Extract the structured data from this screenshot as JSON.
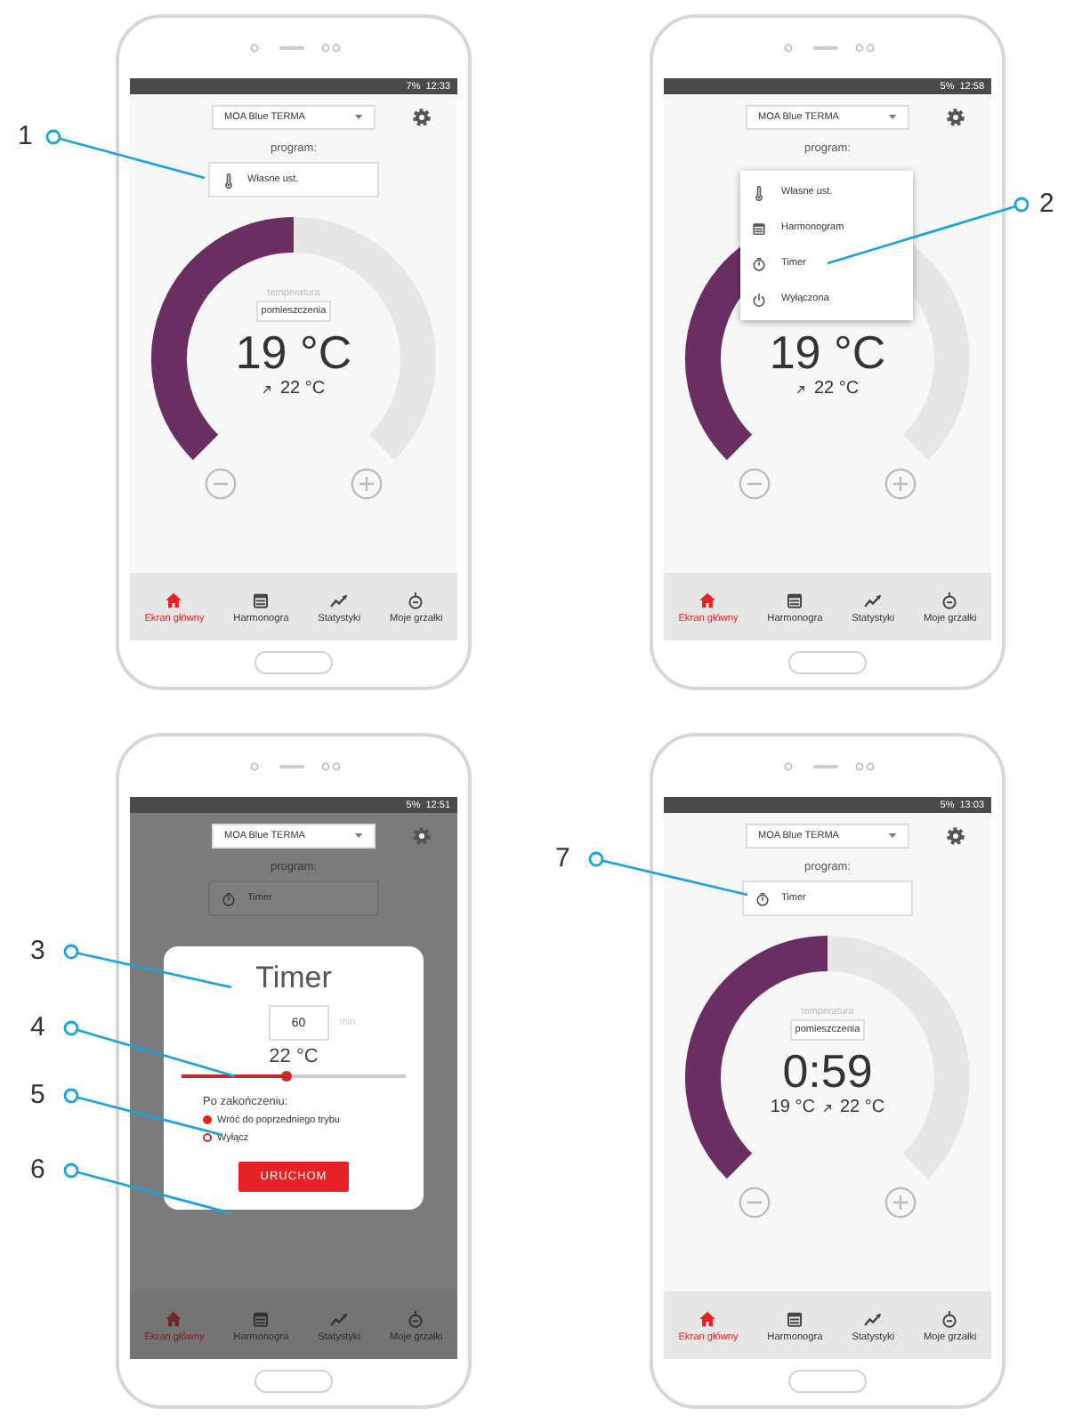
{
  "phones": [
    {
      "kind": "home",
      "status": {
        "battery": "7%",
        "time": "12:33"
      },
      "device": "MOA Blue TERMA",
      "program_label": "program:",
      "program": {
        "kind": "thermo",
        "label": "Własne ust."
      },
      "gauge": {
        "level": 0.5,
        "caption": "temperatura",
        "box": "pomieszczenia",
        "value": "19 °C",
        "target": "22 °C"
      },
      "nav": [
        {
          "kind": "home",
          "label": "Ekran główny",
          "selected": true
        },
        {
          "kind": "calendar",
          "label": "Harmonogra",
          "selected": false
        },
        {
          "kind": "chart",
          "label": "Statystyki",
          "selected": false
        },
        {
          "kind": "dial",
          "label": "Moje grzałki",
          "selected": false
        }
      ]
    },
    {
      "kind": "menu",
      "status": {
        "battery": "5%",
        "time": "12:58"
      },
      "device": "MOA Blue TERMA",
      "program_label": "program:",
      "gauge": {
        "level": 0.5,
        "value": "19 °C",
        "target": "22 °C"
      },
      "menu": [
        {
          "kind": "thermo",
          "label": "Własne ust."
        },
        {
          "kind": "calendar",
          "label": "Harmonogram"
        },
        {
          "kind": "timer",
          "label": "Timer"
        },
        {
          "kind": "power",
          "label": "Wyłączona"
        }
      ],
      "nav": [
        {
          "kind": "home",
          "label": "Ekran główny",
          "selected": true
        },
        {
          "kind": "calendar",
          "label": "Harmonogra",
          "selected": false
        },
        {
          "kind": "chart",
          "label": "Statystyki",
          "selected": false
        },
        {
          "kind": "dial",
          "label": "Moje grzałki",
          "selected": false
        }
      ]
    },
    {
      "kind": "dialog",
      "status": {
        "battery": "5%",
        "time": "12:51"
      },
      "device": "MOA Blue TERMA",
      "program_label": "program:",
      "program": {
        "kind": "timer",
        "label": "Timer"
      },
      "dialog": {
        "title": "Timer",
        "minutes": "60",
        "unit": "min.",
        "temp": "22 °C",
        "level": 0.47,
        "after_label": "Po zakończeniu:",
        "options": [
          {
            "label": "Wróć do poprzedniego trybu",
            "selected": true
          },
          {
            "label": "Wyłącz",
            "selected": false
          }
        ],
        "button": "URUCHOM"
      },
      "nav": [
        {
          "kind": "home",
          "label": "Ekran główny",
          "selected": true
        },
        {
          "kind": "calendar",
          "label": "Harmonogra",
          "selected": false
        },
        {
          "kind": "chart",
          "label": "Statystyki",
          "selected": false
        },
        {
          "kind": "dial",
          "label": "Moje grzałki",
          "selected": false
        }
      ]
    },
    {
      "kind": "home",
      "status": {
        "battery": "5%",
        "time": "13:03"
      },
      "device": "MOA Blue TERMA",
      "program_label": "program:",
      "program": {
        "kind": "timer",
        "label": "Timer"
      },
      "gauge": {
        "level": 0.5,
        "caption": "temperatura",
        "box": "pomieszczenia",
        "value": "0:59",
        "current": "19 °C",
        "target": "22 °C"
      },
      "nav": [
        {
          "kind": "home",
          "label": "Ekran główny",
          "selected": true
        },
        {
          "kind": "calendar",
          "label": "Harmonogra",
          "selected": false
        },
        {
          "kind": "chart",
          "label": "Statystyki",
          "selected": false
        },
        {
          "kind": "dial",
          "label": "Moje grzałki",
          "selected": false
        }
      ]
    }
  ],
  "callouts": [
    {
      "label": "1"
    },
    {
      "label": "2"
    },
    {
      "label": "3"
    },
    {
      "label": "4"
    },
    {
      "label": "5"
    },
    {
      "label": "6"
    },
    {
      "label": "7"
    }
  ]
}
